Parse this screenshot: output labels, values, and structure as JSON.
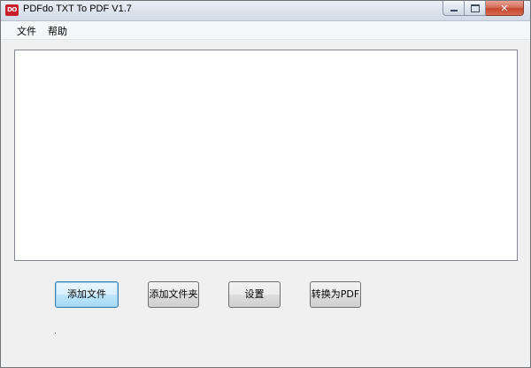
{
  "window": {
    "title": "PDFdo TXT To PDF V1.7",
    "app_icon_text": "DO",
    "app_icon_color": "#c8202a",
    "controls": {
      "minimize": "minimize-icon",
      "maximize": "maximize-icon",
      "close": "close-icon",
      "close_glyph": "✕"
    }
  },
  "menu": {
    "items": [
      {
        "label": "文件"
      },
      {
        "label": "帮助"
      }
    ]
  },
  "file_list": {
    "items": []
  },
  "buttons": {
    "add_file": "添加文件",
    "add_folder": "添加文件夹",
    "settings": "设置",
    "convert": "转换为PDF"
  }
}
